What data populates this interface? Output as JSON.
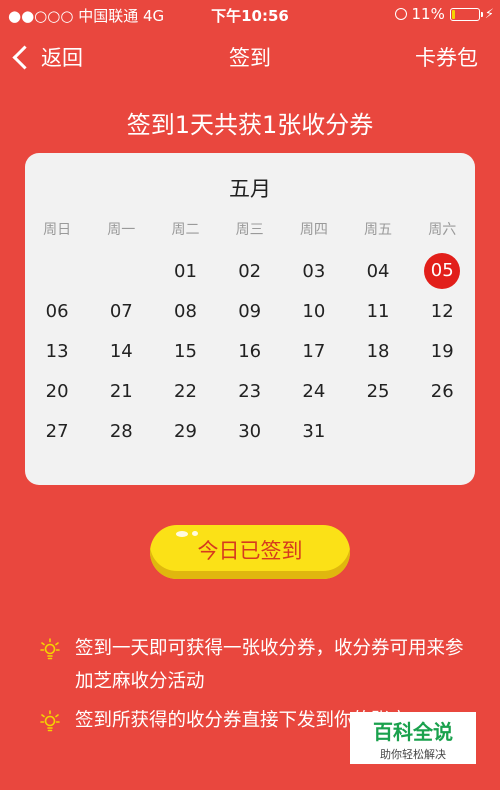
{
  "status_bar": {
    "carrier": "●●○○○ 中国联通 4G",
    "time": "下午10:56",
    "battery": "11%",
    "battery_level": 0.11
  },
  "nav": {
    "back": "返回",
    "title": "签到",
    "right": "卡券包"
  },
  "headline": "签到1天共获1张收分券",
  "calendar": {
    "month": "五月",
    "weekdays": [
      "周日",
      "周一",
      "周二",
      "周三",
      "周四",
      "周五",
      "周六"
    ],
    "weeks": [
      [
        "",
        "",
        "01",
        "02",
        "03",
        "04",
        "05"
      ],
      [
        "06",
        "07",
        "08",
        "09",
        "10",
        "11",
        "12"
      ],
      [
        "13",
        "14",
        "15",
        "16",
        "17",
        "18",
        "19"
      ],
      [
        "20",
        "21",
        "22",
        "23",
        "24",
        "25",
        "26"
      ],
      [
        "27",
        "28",
        "29",
        "30",
        "31",
        "",
        ""
      ]
    ],
    "selected": "05"
  },
  "signed_button": "今日已签到",
  "tips": [
    "签到一天即可获得一张收分券，收分券可用来参加芝麻收分活动",
    "签到所获得的收分券直接下发到你的账户"
  ],
  "watermark": {
    "title": "百科全说",
    "subtitle": "助你轻松解决"
  },
  "colors": {
    "background": "#e9473e",
    "selected_day": "#e21f1a",
    "button": "#fbe117"
  }
}
